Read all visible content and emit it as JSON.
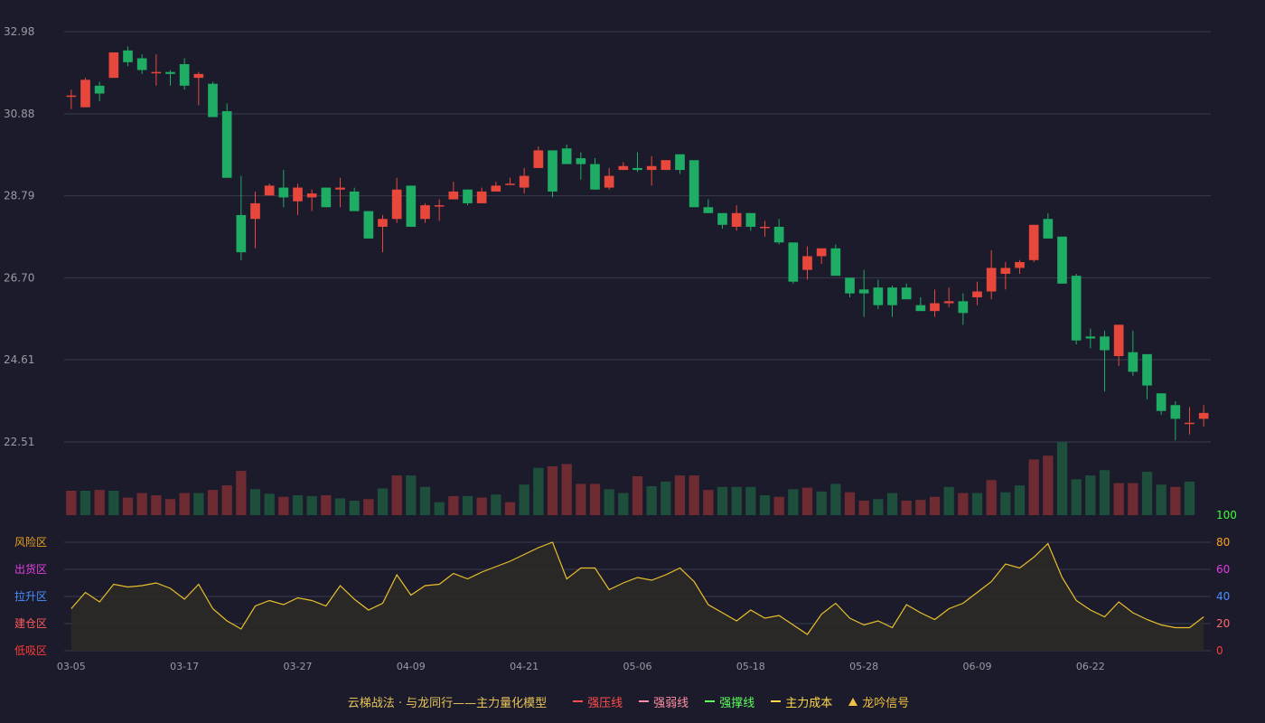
{
  "colors": {
    "background": "#1b1b2b",
    "up": "#e8473c",
    "down": "#1fac64",
    "up_volume": "#6e2c32",
    "down_volume": "#1d4f3c",
    "grid": "#3a3b4d",
    "axis_text": "#9a9aa6",
    "indicator_line": "#e8c02c",
    "indicator_fill": "#2c2a27"
  },
  "chart_data": [
    {
      "type": "candlestick",
      "name": "price",
      "y_ticks": [
        "32.98",
        "30.88",
        "28.79",
        "26.70",
        "24.61",
        "22.51"
      ],
      "ylim": [
        22.51,
        32.98
      ],
      "x_tick_labels": [
        "03-05",
        "03-17",
        "03-27",
        "04-09",
        "04-21",
        "05-06",
        "05-18",
        "05-28",
        "06-09",
        "06-22"
      ],
      "x_tick_indices": [
        0,
        8,
        16,
        24,
        32,
        40,
        48,
        56,
        64,
        72
      ],
      "ohlc": [
        [
          31.35,
          31.5,
          31.0,
          31.35
        ],
        [
          31.05,
          31.8,
          31.05,
          31.75
        ],
        [
          31.6,
          31.7,
          31.2,
          31.4
        ],
        [
          31.8,
          32.45,
          31.8,
          32.45
        ],
        [
          32.5,
          32.6,
          32.1,
          32.2
        ],
        [
          32.3,
          32.4,
          31.9,
          32.0
        ],
        [
          31.95,
          32.4,
          31.6,
          31.95
        ],
        [
          31.95,
          32.0,
          31.6,
          31.9
        ],
        [
          32.15,
          32.3,
          31.5,
          31.6
        ],
        [
          31.8,
          31.95,
          31.1,
          31.9
        ],
        [
          31.65,
          31.7,
          30.85,
          30.8
        ],
        [
          30.95,
          31.15,
          29.35,
          29.25
        ],
        [
          28.3,
          29.3,
          27.15,
          27.35
        ],
        [
          28.2,
          28.9,
          27.45,
          28.6
        ],
        [
          28.8,
          29.1,
          28.8,
          29.05
        ],
        [
          29.0,
          29.45,
          28.5,
          28.75
        ],
        [
          28.65,
          29.1,
          28.3,
          29.0
        ],
        [
          28.75,
          28.95,
          28.4,
          28.85
        ],
        [
          29.0,
          29.0,
          28.5,
          28.5
        ],
        [
          28.95,
          29.25,
          28.5,
          29.0
        ],
        [
          28.9,
          29.0,
          28.4,
          28.4
        ],
        [
          28.4,
          28.4,
          27.85,
          27.7
        ],
        [
          28.0,
          28.3,
          27.35,
          28.2
        ],
        [
          28.2,
          29.25,
          28.1,
          28.95
        ],
        [
          29.05,
          29.0,
          28.0,
          28.0
        ],
        [
          28.2,
          28.6,
          28.1,
          28.55
        ],
        [
          28.55,
          28.7,
          28.15,
          28.55
        ],
        [
          28.7,
          29.15,
          28.7,
          28.9
        ],
        [
          28.95,
          28.95,
          28.55,
          28.6
        ],
        [
          28.6,
          29.0,
          28.6,
          28.9
        ],
        [
          28.9,
          29.15,
          28.9,
          29.05
        ],
        [
          29.1,
          29.25,
          29.1,
          29.1
        ],
        [
          29.0,
          29.5,
          28.85,
          29.3
        ],
        [
          29.5,
          30.05,
          29.5,
          29.95
        ],
        [
          29.95,
          29.85,
          28.75,
          28.9
        ],
        [
          30.0,
          30.1,
          29.65,
          29.6
        ],
        [
          29.75,
          29.9,
          29.2,
          29.6
        ],
        [
          29.6,
          29.75,
          28.95,
          28.95
        ],
        [
          29.0,
          29.5,
          28.95,
          29.3
        ],
        [
          29.45,
          29.65,
          29.45,
          29.55
        ],
        [
          29.5,
          29.9,
          29.4,
          29.45
        ],
        [
          29.45,
          29.8,
          29.05,
          29.55
        ],
        [
          29.45,
          29.7,
          29.45,
          29.7
        ],
        [
          29.85,
          29.85,
          29.35,
          29.45
        ],
        [
          29.7,
          29.55,
          28.5,
          28.5
        ],
        [
          28.5,
          28.7,
          28.35,
          28.35
        ],
        [
          28.35,
          28.3,
          27.95,
          28.05
        ],
        [
          28.0,
          28.55,
          27.9,
          28.35
        ],
        [
          28.35,
          28.25,
          27.9,
          28.0
        ],
        [
          28.0,
          28.15,
          27.75,
          28.0
        ],
        [
          28.0,
          28.2,
          27.55,
          27.6
        ],
        [
          27.6,
          27.55,
          26.55,
          26.6
        ],
        [
          26.9,
          27.5,
          26.65,
          27.25
        ],
        [
          27.25,
          27.45,
          27.05,
          27.45
        ],
        [
          27.45,
          27.55,
          26.95,
          26.75
        ],
        [
          26.7,
          26.7,
          26.2,
          26.3
        ],
        [
          26.4,
          26.9,
          25.7,
          26.3
        ],
        [
          26.45,
          26.65,
          25.9,
          26.0
        ],
        [
          26.45,
          26.5,
          25.7,
          26.0
        ],
        [
          26.45,
          26.55,
          26.15,
          26.15
        ],
        [
          26.0,
          26.2,
          25.85,
          25.85
        ],
        [
          25.85,
          26.4,
          25.7,
          26.05
        ],
        [
          26.05,
          26.45,
          25.95,
          26.1
        ],
        [
          26.1,
          26.3,
          25.5,
          25.8
        ],
        [
          26.2,
          26.6,
          26.0,
          26.35
        ],
        [
          26.35,
          27.4,
          26.15,
          26.95
        ],
        [
          26.8,
          27.1,
          26.4,
          26.95
        ],
        [
          26.95,
          27.15,
          26.8,
          27.1
        ],
        [
          27.15,
          28.05,
          27.1,
          28.05
        ],
        [
          28.2,
          28.35,
          27.8,
          27.7
        ],
        [
          27.75,
          27.7,
          26.65,
          26.55
        ],
        [
          26.75,
          26.8,
          25.0,
          25.1
        ],
        [
          25.2,
          25.4,
          24.9,
          25.15
        ],
        [
          25.2,
          25.35,
          23.8,
          24.85
        ],
        [
          24.7,
          25.5,
          24.45,
          25.5
        ],
        [
          24.8,
          25.35,
          24.2,
          24.3
        ],
        [
          24.75,
          24.7,
          23.6,
          23.95
        ],
        [
          23.75,
          23.75,
          23.2,
          23.3
        ],
        [
          23.45,
          23.55,
          22.55,
          23.1
        ],
        [
          23.0,
          23.4,
          22.7,
          23.0
        ],
        [
          23.1,
          23.45,
          22.9,
          23.25
        ]
      ]
    },
    {
      "type": "bar",
      "name": "volume",
      "values": [
        32,
        32,
        33,
        32,
        23,
        29,
        26,
        21,
        29,
        29,
        33,
        39,
        58,
        34,
        28,
        24,
        26,
        25,
        26,
        22,
        19,
        21,
        35,
        52,
        52,
        37,
        17,
        25,
        25,
        23,
        27,
        17,
        40,
        62,
        64,
        67,
        41,
        41,
        34,
        29,
        51,
        38,
        44,
        52,
        52,
        33,
        37,
        37,
        37,
        26,
        24,
        34,
        36,
        31,
        41,
        30,
        19,
        21,
        29,
        19,
        20,
        24,
        37,
        29,
        29,
        46,
        30,
        39,
        73,
        78,
        96,
        47,
        52,
        59,
        42,
        42,
        57,
        40,
        37,
        44
      ],
      "up": [
        true,
        false,
        true,
        false,
        true,
        true,
        true,
        true,
        true,
        false,
        true,
        true,
        true,
        false,
        false,
        true,
        false,
        false,
        true,
        false,
        false,
        true,
        false,
        true,
        false,
        false,
        false,
        true,
        false,
        true,
        false,
        true,
        false,
        false,
        true,
        true,
        true,
        true,
        false,
        false,
        true,
        false,
        false,
        true,
        true,
        true,
        false,
        false,
        false,
        false,
        true,
        false,
        true,
        false,
        false,
        true,
        true,
        false,
        false,
        true,
        true,
        true,
        false,
        true,
        false,
        true,
        false,
        false,
        true,
        true,
        false,
        false,
        false,
        false,
        true,
        true,
        false,
        false,
        true,
        false,
        true
      ]
    },
    {
      "type": "area",
      "name": "indicator",
      "ylim": [
        0,
        100
      ],
      "y_ticks": [
        "100",
        "80",
        "60",
        "40",
        "20",
        "0"
      ],
      "zones": [
        "风险区",
        "出货区",
        "拉升区",
        "建仓区",
        "低吸区"
      ],
      "values": [
        31,
        43,
        36,
        49,
        47,
        48,
        50,
        46,
        38,
        49,
        31,
        22,
        16,
        33,
        37,
        34,
        39,
        37,
        33,
        48,
        38,
        30,
        35,
        56,
        41,
        48,
        49,
        57,
        53,
        58,
        62,
        66,
        71,
        76,
        80,
        53,
        61,
        61,
        45,
        50,
        54,
        52,
        56,
        61,
        51,
        34,
        28,
        22,
        30,
        24,
        26,
        19,
        12,
        27,
        35,
        24,
        19,
        22,
        17,
        34,
        28,
        23,
        31,
        35,
        43,
        51,
        64,
        61,
        69,
        79,
        54,
        37,
        30,
        25,
        36,
        28,
        23,
        19,
        17,
        17,
        25
      ]
    }
  ],
  "legend": {
    "title": "云梯战法 · 与龙同行——主力量化模型",
    "items": [
      {
        "label": "强压线",
        "color": "#ff4d4d",
        "style": "solid"
      },
      {
        "label": "强弱线",
        "color": "#ff8fa3",
        "style": "dashed"
      },
      {
        "label": "强撑线",
        "color": "#5bff5b",
        "style": "solid"
      },
      {
        "label": "主力成本",
        "color": "#ffd84a",
        "style": "dashed"
      },
      {
        "label": "龙吟信号",
        "color": "#f0c040",
        "style": "triangle"
      }
    ]
  }
}
